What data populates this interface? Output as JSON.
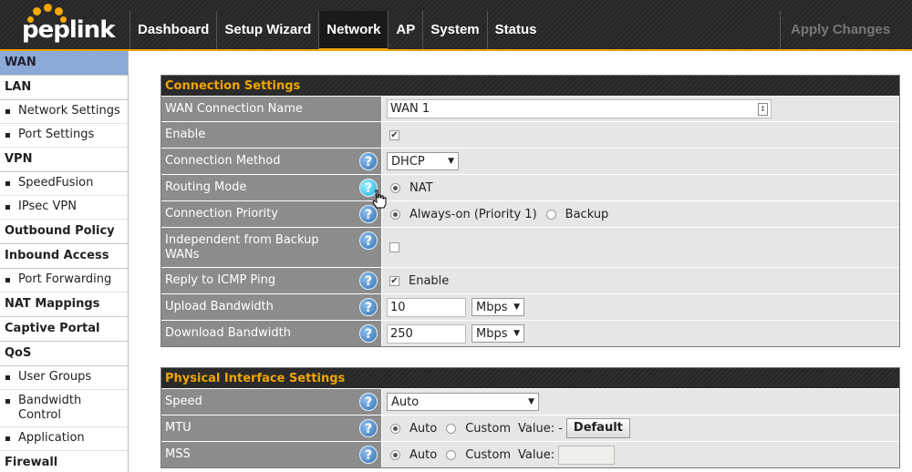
{
  "brand": {
    "logo_text": "peplink",
    "accent": "#f0a400"
  },
  "nav": {
    "tabs": [
      "Dashboard",
      "Setup Wizard",
      "Network",
      "AP",
      "System",
      "Status"
    ],
    "active": "Network",
    "apply_label": "Apply Changes"
  },
  "sidebar": {
    "wan": "WAN",
    "lan": "LAN",
    "lan_network_settings": "Network Settings",
    "lan_port_settings": "Port Settings",
    "vpn": "VPN",
    "vpn_speedfusion": "SpeedFusion",
    "vpn_ipsec": "IPsec VPN",
    "outbound_policy": "Outbound Policy",
    "inbound_access": "Inbound Access",
    "port_forwarding": "Port Forwarding",
    "nat_mappings": "NAT Mappings",
    "captive_portal": "Captive Portal",
    "qos": "QoS",
    "user_groups": "User Groups",
    "bandwidth_control": "Bandwidth Control",
    "application": "Application",
    "firewall": "Firewall"
  },
  "connection": {
    "title": "Connection Settings",
    "name_label": "WAN Connection Name",
    "name_value": "WAN 1",
    "enable_label": "Enable",
    "enable_checked": true,
    "method_label": "Connection Method",
    "method_value": "DHCP",
    "routing_label": "Routing Mode",
    "routing_option": "NAT",
    "priority_label": "Connection Priority",
    "priority_alwayson": "Always-on (Priority 1)",
    "priority_backup": "Backup",
    "independent_label": "Independent from Backup WANs",
    "icmp_label": "Reply to ICMP Ping",
    "icmp_option": "Enable",
    "upload_label": "Upload Bandwidth",
    "upload_value": "10",
    "upload_unit": "Mbps",
    "download_label": "Download Bandwidth",
    "download_value": "250",
    "download_unit": "Mbps"
  },
  "physical": {
    "title": "Physical Interface Settings",
    "speed_label": "Speed",
    "speed_value": "Auto",
    "mtu_label": "MTU",
    "mtu_auto": "Auto",
    "mtu_custom": "Custom",
    "mtu_value_label": "Value: -",
    "mtu_default_button": "Default",
    "mss_label": "MSS",
    "mss_auto": "Auto",
    "mss_custom": "Custom",
    "mss_value_label": "Value:"
  }
}
